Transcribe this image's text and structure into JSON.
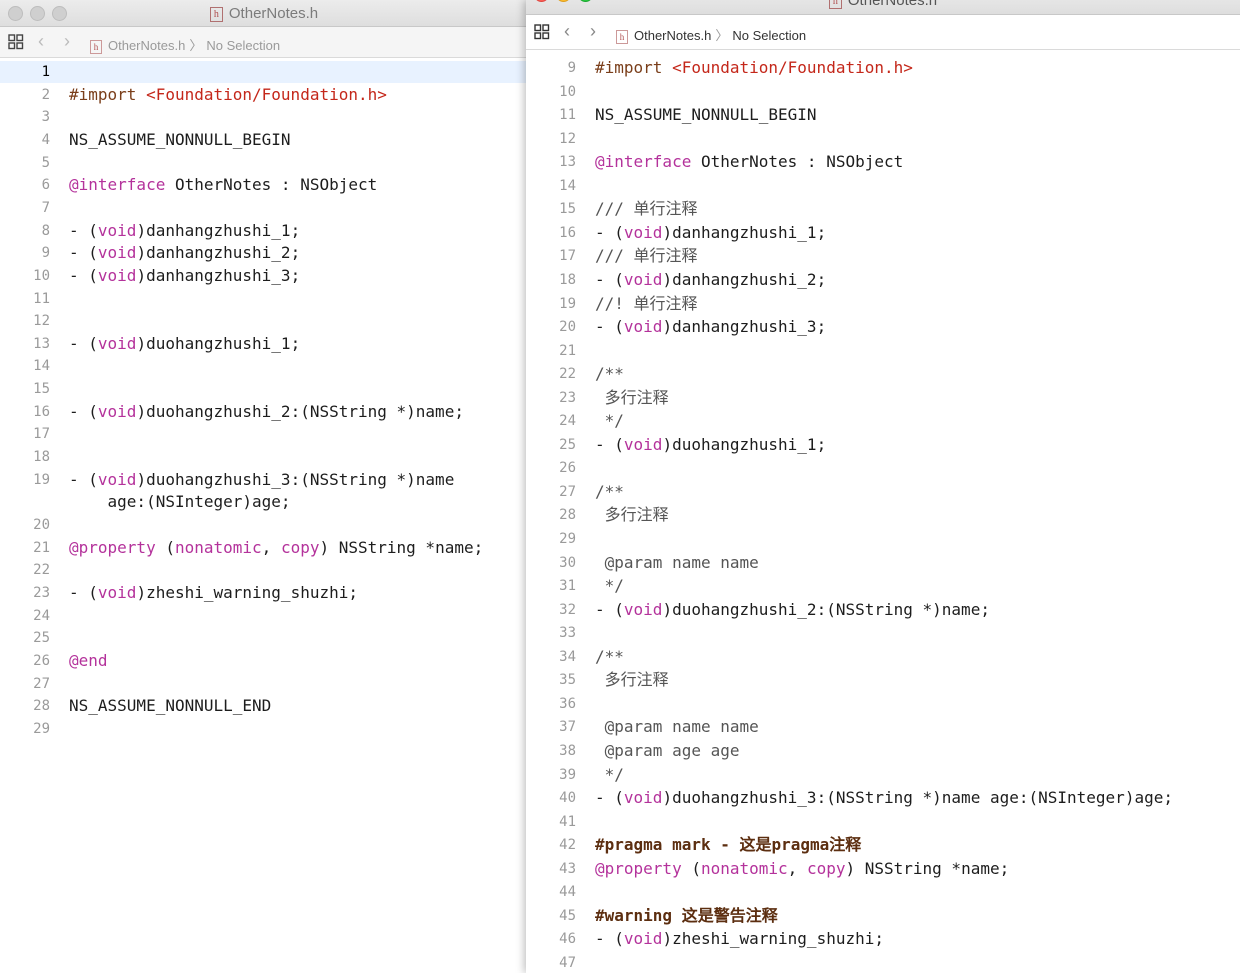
{
  "left_window": {
    "title": "OtherNotes.h",
    "breadcrumb": {
      "file": "OtherNotes.h",
      "selection": "No Selection"
    },
    "current_line": "1",
    "lines": [
      {
        "n": "1",
        "segs": []
      },
      {
        "n": "2",
        "segs": [
          {
            "c": "prep",
            "t": "#import "
          },
          {
            "c": "str",
            "t": "<Foundation/Foundation.h>"
          }
        ]
      },
      {
        "n": "3",
        "segs": []
      },
      {
        "n": "4",
        "segs": [
          {
            "c": "",
            "t": "NS_ASSUME_NONNULL_BEGIN"
          }
        ]
      },
      {
        "n": "5",
        "segs": []
      },
      {
        "n": "6",
        "segs": [
          {
            "c": "kw",
            "t": "@interface"
          },
          {
            "c": "",
            "t": " OtherNotes : NSObject"
          }
        ]
      },
      {
        "n": "7",
        "segs": []
      },
      {
        "n": "8",
        "segs": [
          {
            "c": "",
            "t": "- ("
          },
          {
            "c": "kw",
            "t": "void"
          },
          {
            "c": "",
            "t": ")danhangzhushi_1;"
          }
        ]
      },
      {
        "n": "9",
        "segs": [
          {
            "c": "",
            "t": "- ("
          },
          {
            "c": "kw",
            "t": "void"
          },
          {
            "c": "",
            "t": ")danhangzhushi_2;"
          }
        ]
      },
      {
        "n": "10",
        "segs": [
          {
            "c": "",
            "t": "- ("
          },
          {
            "c": "kw",
            "t": "void"
          },
          {
            "c": "",
            "t": ")danhangzhushi_3;"
          }
        ]
      },
      {
        "n": "11",
        "segs": []
      },
      {
        "n": "12",
        "segs": []
      },
      {
        "n": "13",
        "segs": [
          {
            "c": "",
            "t": "- ("
          },
          {
            "c": "kw",
            "t": "void"
          },
          {
            "c": "",
            "t": ")duohangzhushi_1;"
          }
        ]
      },
      {
        "n": "14",
        "segs": []
      },
      {
        "n": "15",
        "segs": []
      },
      {
        "n": "16",
        "segs": [
          {
            "c": "",
            "t": "- ("
          },
          {
            "c": "kw",
            "t": "void"
          },
          {
            "c": "",
            "t": ")duohangzhushi_2:(NSString *)name;"
          }
        ]
      },
      {
        "n": "17",
        "segs": []
      },
      {
        "n": "18",
        "segs": []
      },
      {
        "n": "19",
        "segs": [
          {
            "c": "",
            "t": "- ("
          },
          {
            "c": "kw",
            "t": "void"
          },
          {
            "c": "",
            "t": ")duohangzhushi_3:(NSString *)name"
          }
        ]
      },
      {
        "n": "",
        "segs": [
          {
            "c": "",
            "t": "    age:(NSInteger)age;"
          }
        ]
      },
      {
        "n": "20",
        "segs": []
      },
      {
        "n": "21",
        "segs": [
          {
            "c": "kw",
            "t": "@property"
          },
          {
            "c": "",
            "t": " ("
          },
          {
            "c": "kw",
            "t": "nonatomic"
          },
          {
            "c": "",
            "t": ", "
          },
          {
            "c": "kw",
            "t": "copy"
          },
          {
            "c": "",
            "t": ") NSString *name;"
          }
        ]
      },
      {
        "n": "22",
        "segs": []
      },
      {
        "n": "23",
        "segs": [
          {
            "c": "",
            "t": "- ("
          },
          {
            "c": "kw",
            "t": "void"
          },
          {
            "c": "",
            "t": ")zheshi_warning_shuzhi;"
          }
        ]
      },
      {
        "n": "24",
        "segs": []
      },
      {
        "n": "25",
        "segs": []
      },
      {
        "n": "26",
        "segs": [
          {
            "c": "kw",
            "t": "@end"
          }
        ]
      },
      {
        "n": "27",
        "segs": []
      },
      {
        "n": "28",
        "segs": [
          {
            "c": "",
            "t": "NS_ASSUME_NONNULL_END"
          }
        ]
      },
      {
        "n": "29",
        "segs": []
      }
    ]
  },
  "right_window": {
    "title": "OtherNotes.h",
    "breadcrumb": {
      "file": "OtherNotes.h",
      "selection": "No Selection"
    },
    "lines": [
      {
        "n": "9",
        "segs": [
          {
            "c": "prep",
            "t": "#import "
          },
          {
            "c": "str",
            "t": "<Foundation/Foundation.h>"
          }
        ]
      },
      {
        "n": "10",
        "segs": []
      },
      {
        "n": "11",
        "segs": [
          {
            "c": "",
            "t": "NS_ASSUME_NONNULL_BEGIN"
          }
        ]
      },
      {
        "n": "12",
        "segs": []
      },
      {
        "n": "13",
        "segs": [
          {
            "c": "kw",
            "t": "@interface"
          },
          {
            "c": "",
            "t": " OtherNotes : NSObject"
          }
        ]
      },
      {
        "n": "14",
        "segs": []
      },
      {
        "n": "15",
        "segs": [
          {
            "c": "cmt",
            "t": "/// 单行注释"
          }
        ]
      },
      {
        "n": "16",
        "segs": [
          {
            "c": "",
            "t": "- ("
          },
          {
            "c": "kw",
            "t": "void"
          },
          {
            "c": "",
            "t": ")danhangzhushi_1;"
          }
        ]
      },
      {
        "n": "17",
        "segs": [
          {
            "c": "cmt",
            "t": "/// 单行注释"
          }
        ]
      },
      {
        "n": "18",
        "segs": [
          {
            "c": "",
            "t": "- ("
          },
          {
            "c": "kw",
            "t": "void"
          },
          {
            "c": "",
            "t": ")danhangzhushi_2;"
          }
        ]
      },
      {
        "n": "19",
        "segs": [
          {
            "c": "cmt",
            "t": "//! 单行注释"
          }
        ]
      },
      {
        "n": "20",
        "segs": [
          {
            "c": "",
            "t": "- ("
          },
          {
            "c": "kw",
            "t": "void"
          },
          {
            "c": "",
            "t": ")danhangzhushi_3;"
          }
        ]
      },
      {
        "n": "21",
        "segs": []
      },
      {
        "n": "22",
        "segs": [
          {
            "c": "cmt",
            "t": "/**"
          }
        ]
      },
      {
        "n": "23",
        "segs": [
          {
            "c": "cmt",
            "t": " 多行注释"
          }
        ]
      },
      {
        "n": "24",
        "segs": [
          {
            "c": "cmt",
            "t": " */"
          }
        ]
      },
      {
        "n": "25",
        "segs": [
          {
            "c": "",
            "t": "- ("
          },
          {
            "c": "kw",
            "t": "void"
          },
          {
            "c": "",
            "t": ")duohangzhushi_1;"
          }
        ]
      },
      {
        "n": "26",
        "segs": []
      },
      {
        "n": "27",
        "segs": [
          {
            "c": "cmt",
            "t": "/**"
          }
        ]
      },
      {
        "n": "28",
        "segs": [
          {
            "c": "cmt",
            "t": " 多行注释"
          }
        ]
      },
      {
        "n": "29",
        "segs": []
      },
      {
        "n": "30",
        "segs": [
          {
            "c": "cmt",
            "t": " @param name name"
          }
        ]
      },
      {
        "n": "31",
        "segs": [
          {
            "c": "cmt",
            "t": " */"
          }
        ]
      },
      {
        "n": "32",
        "segs": [
          {
            "c": "",
            "t": "- ("
          },
          {
            "c": "kw",
            "t": "void"
          },
          {
            "c": "",
            "t": ")duohangzhushi_2:(NSString *)name;"
          }
        ]
      },
      {
        "n": "33",
        "segs": []
      },
      {
        "n": "34",
        "segs": [
          {
            "c": "cmt",
            "t": "/**"
          }
        ]
      },
      {
        "n": "35",
        "segs": [
          {
            "c": "cmt",
            "t": " 多行注释"
          }
        ]
      },
      {
        "n": "36",
        "segs": []
      },
      {
        "n": "37",
        "segs": [
          {
            "c": "cmt",
            "t": " @param name name"
          }
        ]
      },
      {
        "n": "38",
        "segs": [
          {
            "c": "cmt",
            "t": " @param age age"
          }
        ]
      },
      {
        "n": "39",
        "segs": [
          {
            "c": "cmt",
            "t": " */"
          }
        ]
      },
      {
        "n": "40",
        "segs": [
          {
            "c": "",
            "t": "- ("
          },
          {
            "c": "kw",
            "t": "void"
          },
          {
            "c": "",
            "t": ")duohangzhushi_3:(NSString *)name age:(NSInteger)age;"
          }
        ]
      },
      {
        "n": "41",
        "segs": []
      },
      {
        "n": "42",
        "segs": [
          {
            "c": "mark",
            "t": "#pragma mark - 这是pragma注释"
          }
        ]
      },
      {
        "n": "43",
        "segs": [
          {
            "c": "kw",
            "t": "@property"
          },
          {
            "c": "",
            "t": " ("
          },
          {
            "c": "kw",
            "t": "nonatomic"
          },
          {
            "c": "",
            "t": ", "
          },
          {
            "c": "kw",
            "t": "copy"
          },
          {
            "c": "",
            "t": ") NSString *name;"
          }
        ]
      },
      {
        "n": "44",
        "segs": []
      },
      {
        "n": "45",
        "segs": [
          {
            "c": "mark",
            "t": "#warning 这是警告注释"
          }
        ]
      },
      {
        "n": "46",
        "segs": [
          {
            "c": "",
            "t": "- ("
          },
          {
            "c": "kw",
            "t": "void"
          },
          {
            "c": "",
            "t": ")zheshi_warning_shuzhi;"
          }
        ]
      },
      {
        "n": "47",
        "segs": []
      }
    ]
  }
}
